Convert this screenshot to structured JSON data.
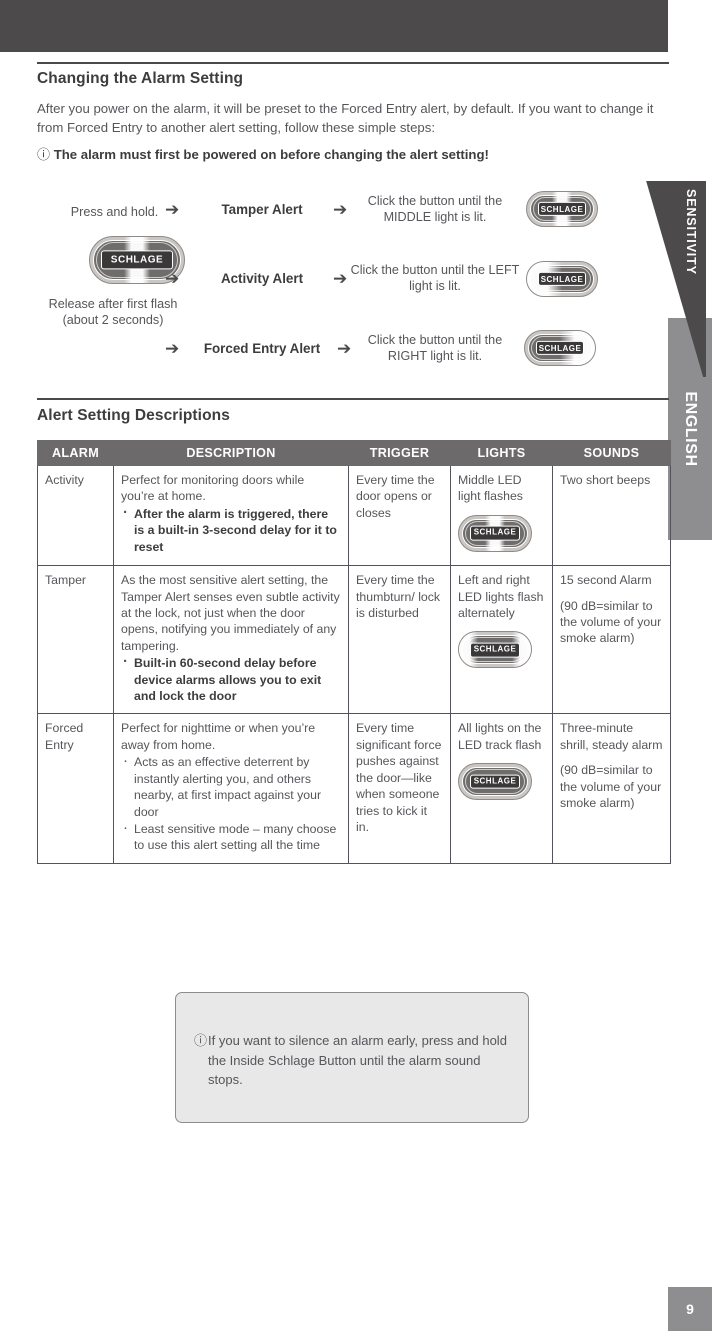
{
  "page": {
    "number": "9",
    "language_tab": "ENGLISH"
  },
  "sections": {
    "changing_heading": "Changing the Alarm Setting",
    "intro_paragraph": "After you power on the alarm, it will be preset to the Forced Entry alert, by default. If you want to change it from Forced Entry to another alert setting, follow these simple steps:",
    "notice": "The alarm must first be powered on before changing the alert setting!",
    "notice_icon": "info-circle-icon",
    "alert_descriptions_heading": "Alert Setting Descriptions"
  },
  "diagram": {
    "press_hold_label": "Press and hold.",
    "release_label": "Release after first flash (about 2 seconds)",
    "device_icon_label": "SCHLAGE",
    "arrow_icon": "right-arrow-icon",
    "sensitivity_label": "SENSITIVITY",
    "steps": [
      {
        "alert": "Tamper Alert",
        "instruction": "Click the button until the MIDDLE light is lit.",
        "led_state": "middle"
      },
      {
        "alert": "Activity Alert",
        "instruction": "Click the button until the LEFT light is lit.",
        "led_state": "left"
      },
      {
        "alert": "Forced Entry Alert",
        "instruction": "Click the button until the RIGHT light is lit.",
        "led_state": "right"
      }
    ]
  },
  "table": {
    "headers": [
      "ALARM",
      "DESCRIPTION",
      "TRIGGER",
      "LIGHTS",
      "SOUNDS"
    ],
    "rows": [
      {
        "alarm": "Activity",
        "description_intro": "Perfect for monitoring doors while you’re at home.",
        "description_bullets": [
          {
            "text": "After the alarm is triggered, there is a built-in 3-second delay for it to reset",
            "bold": true
          }
        ],
        "trigger": "Every time the door opens or closes",
        "lights": "Middle LED light flashes",
        "lights_led_state": "middle",
        "sounds_primary": "Two short beeps",
        "sounds_secondary": ""
      },
      {
        "alarm": "Tamper",
        "description_intro": "As the most sensitive alert setting, the Tamper Alert senses even subtle activity at the lock, not just when the door opens, notifying you immediately of any tampering.",
        "description_bullets": [
          {
            "text": "Built-in 60-second delay before device alarms allows you to exit and lock the door",
            "bold": true
          }
        ],
        "trigger": "Every time the thumbturn/ lock is disturbed",
        "lights": "Left and right LED lights flash alternately",
        "lights_led_state": "both",
        "sounds_primary": "15 second Alarm",
        "sounds_secondary": "(90 dB=similar to the volume of your smoke alarm)"
      },
      {
        "alarm": "Forced Entry",
        "description_intro": "Perfect for nighttime or when you’re away from home.",
        "description_bullets": [
          {
            "text": "Acts as an effective deterrent by instantly alerting you, and others nearby, at first impact against your door",
            "bold": false
          },
          {
            "text": "Least sensitive mode – many choose to use this alert setting all the time",
            "bold": false
          }
        ],
        "trigger": "Every time significant force pushes against the door—like when someone tries to kick it in.",
        "lights": "All lights on the LED track flash",
        "lights_led_state": "all",
        "sounds_primary": "Three-minute shrill, steady alarm",
        "sounds_secondary": "(90 dB=similar to the volume of your smoke alarm)"
      }
    ]
  },
  "note_box": {
    "icon": "info-circle-icon",
    "text": "If you want to silence an alarm early, press and hold the Inside Schlage Button until the alarm sound stops."
  },
  "colors": {
    "header_bar": "#4c4a4b",
    "table_header": "#6d6a6b",
    "tab_gray": "#8e8e90",
    "note_bg": "#e8e8e8",
    "body_text": "#57555a"
  }
}
